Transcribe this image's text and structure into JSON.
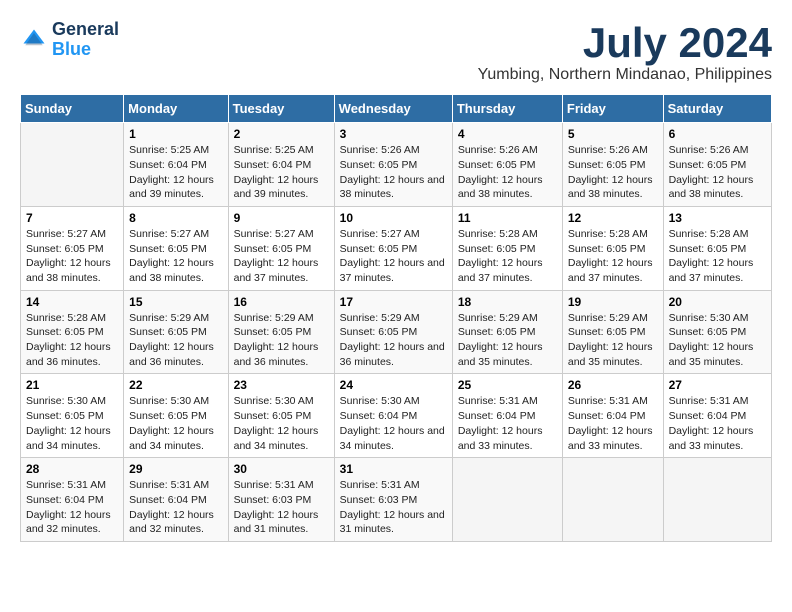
{
  "logo": {
    "line1": "General",
    "line2": "Blue"
  },
  "title": "July 2024",
  "subtitle": "Yumbing, Northern Mindanao, Philippines",
  "weekdays": [
    "Sunday",
    "Monday",
    "Tuesday",
    "Wednesday",
    "Thursday",
    "Friday",
    "Saturday"
  ],
  "weeks": [
    [
      {
        "day": "",
        "sunrise": "",
        "sunset": "",
        "daylight": ""
      },
      {
        "day": "1",
        "sunrise": "Sunrise: 5:25 AM",
        "sunset": "Sunset: 6:04 PM",
        "daylight": "Daylight: 12 hours and 39 minutes."
      },
      {
        "day": "2",
        "sunrise": "Sunrise: 5:25 AM",
        "sunset": "Sunset: 6:04 PM",
        "daylight": "Daylight: 12 hours and 39 minutes."
      },
      {
        "day": "3",
        "sunrise": "Sunrise: 5:26 AM",
        "sunset": "Sunset: 6:05 PM",
        "daylight": "Daylight: 12 hours and 38 minutes."
      },
      {
        "day": "4",
        "sunrise": "Sunrise: 5:26 AM",
        "sunset": "Sunset: 6:05 PM",
        "daylight": "Daylight: 12 hours and 38 minutes."
      },
      {
        "day": "5",
        "sunrise": "Sunrise: 5:26 AM",
        "sunset": "Sunset: 6:05 PM",
        "daylight": "Daylight: 12 hours and 38 minutes."
      },
      {
        "day": "6",
        "sunrise": "Sunrise: 5:26 AM",
        "sunset": "Sunset: 6:05 PM",
        "daylight": "Daylight: 12 hours and 38 minutes."
      }
    ],
    [
      {
        "day": "7",
        "sunrise": "Sunrise: 5:27 AM",
        "sunset": "Sunset: 6:05 PM",
        "daylight": "Daylight: 12 hours and 38 minutes."
      },
      {
        "day": "8",
        "sunrise": "Sunrise: 5:27 AM",
        "sunset": "Sunset: 6:05 PM",
        "daylight": "Daylight: 12 hours and 38 minutes."
      },
      {
        "day": "9",
        "sunrise": "Sunrise: 5:27 AM",
        "sunset": "Sunset: 6:05 PM",
        "daylight": "Daylight: 12 hours and 37 minutes."
      },
      {
        "day": "10",
        "sunrise": "Sunrise: 5:27 AM",
        "sunset": "Sunset: 6:05 PM",
        "daylight": "Daylight: 12 hours and 37 minutes."
      },
      {
        "day": "11",
        "sunrise": "Sunrise: 5:28 AM",
        "sunset": "Sunset: 6:05 PM",
        "daylight": "Daylight: 12 hours and 37 minutes."
      },
      {
        "day": "12",
        "sunrise": "Sunrise: 5:28 AM",
        "sunset": "Sunset: 6:05 PM",
        "daylight": "Daylight: 12 hours and 37 minutes."
      },
      {
        "day": "13",
        "sunrise": "Sunrise: 5:28 AM",
        "sunset": "Sunset: 6:05 PM",
        "daylight": "Daylight: 12 hours and 37 minutes."
      }
    ],
    [
      {
        "day": "14",
        "sunrise": "Sunrise: 5:28 AM",
        "sunset": "Sunset: 6:05 PM",
        "daylight": "Daylight: 12 hours and 36 minutes."
      },
      {
        "day": "15",
        "sunrise": "Sunrise: 5:29 AM",
        "sunset": "Sunset: 6:05 PM",
        "daylight": "Daylight: 12 hours and 36 minutes."
      },
      {
        "day": "16",
        "sunrise": "Sunrise: 5:29 AM",
        "sunset": "Sunset: 6:05 PM",
        "daylight": "Daylight: 12 hours and 36 minutes."
      },
      {
        "day": "17",
        "sunrise": "Sunrise: 5:29 AM",
        "sunset": "Sunset: 6:05 PM",
        "daylight": "Daylight: 12 hours and 36 minutes."
      },
      {
        "day": "18",
        "sunrise": "Sunrise: 5:29 AM",
        "sunset": "Sunset: 6:05 PM",
        "daylight": "Daylight: 12 hours and 35 minutes."
      },
      {
        "day": "19",
        "sunrise": "Sunrise: 5:29 AM",
        "sunset": "Sunset: 6:05 PM",
        "daylight": "Daylight: 12 hours and 35 minutes."
      },
      {
        "day": "20",
        "sunrise": "Sunrise: 5:30 AM",
        "sunset": "Sunset: 6:05 PM",
        "daylight": "Daylight: 12 hours and 35 minutes."
      }
    ],
    [
      {
        "day": "21",
        "sunrise": "Sunrise: 5:30 AM",
        "sunset": "Sunset: 6:05 PM",
        "daylight": "Daylight: 12 hours and 34 minutes."
      },
      {
        "day": "22",
        "sunrise": "Sunrise: 5:30 AM",
        "sunset": "Sunset: 6:05 PM",
        "daylight": "Daylight: 12 hours and 34 minutes."
      },
      {
        "day": "23",
        "sunrise": "Sunrise: 5:30 AM",
        "sunset": "Sunset: 6:05 PM",
        "daylight": "Daylight: 12 hours and 34 minutes."
      },
      {
        "day": "24",
        "sunrise": "Sunrise: 5:30 AM",
        "sunset": "Sunset: 6:04 PM",
        "daylight": "Daylight: 12 hours and 34 minutes."
      },
      {
        "day": "25",
        "sunrise": "Sunrise: 5:31 AM",
        "sunset": "Sunset: 6:04 PM",
        "daylight": "Daylight: 12 hours and 33 minutes."
      },
      {
        "day": "26",
        "sunrise": "Sunrise: 5:31 AM",
        "sunset": "Sunset: 6:04 PM",
        "daylight": "Daylight: 12 hours and 33 minutes."
      },
      {
        "day": "27",
        "sunrise": "Sunrise: 5:31 AM",
        "sunset": "Sunset: 6:04 PM",
        "daylight": "Daylight: 12 hours and 33 minutes."
      }
    ],
    [
      {
        "day": "28",
        "sunrise": "Sunrise: 5:31 AM",
        "sunset": "Sunset: 6:04 PM",
        "daylight": "Daylight: 12 hours and 32 minutes."
      },
      {
        "day": "29",
        "sunrise": "Sunrise: 5:31 AM",
        "sunset": "Sunset: 6:04 PM",
        "daylight": "Daylight: 12 hours and 32 minutes."
      },
      {
        "day": "30",
        "sunrise": "Sunrise: 5:31 AM",
        "sunset": "Sunset: 6:03 PM",
        "daylight": "Daylight: 12 hours and 31 minutes."
      },
      {
        "day": "31",
        "sunrise": "Sunrise: 5:31 AM",
        "sunset": "Sunset: 6:03 PM",
        "daylight": "Daylight: 12 hours and 31 minutes."
      },
      {
        "day": "",
        "sunrise": "",
        "sunset": "",
        "daylight": ""
      },
      {
        "day": "",
        "sunrise": "",
        "sunset": "",
        "daylight": ""
      },
      {
        "day": "",
        "sunrise": "",
        "sunset": "",
        "daylight": ""
      }
    ]
  ]
}
